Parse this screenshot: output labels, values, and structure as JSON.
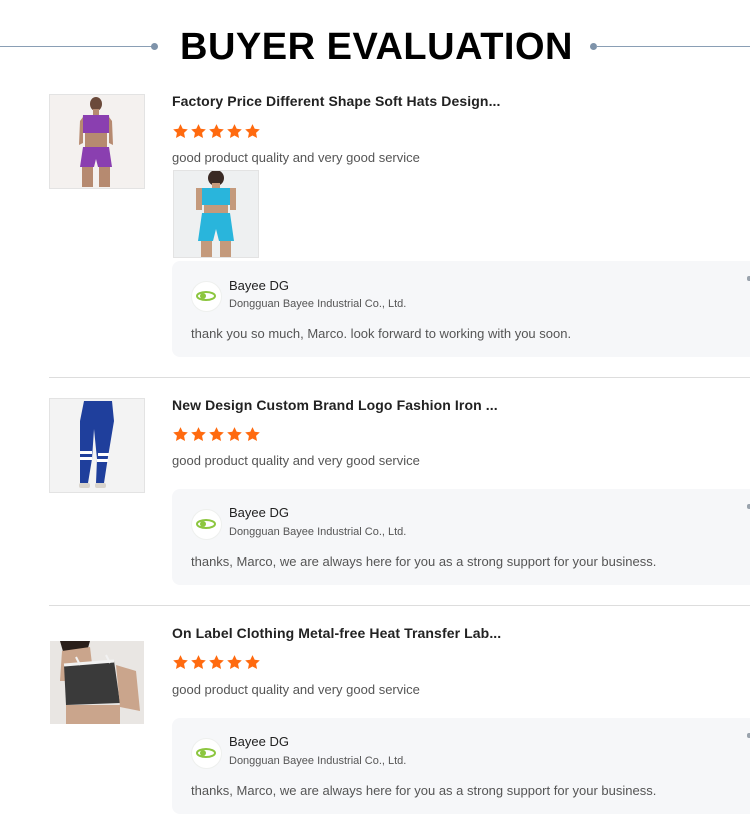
{
  "header": {
    "title": "BUYER EVALUATION"
  },
  "colors": {
    "star": "#ff6a0f",
    "reply_bg": "#f6f7f9",
    "divider": "#dddddd",
    "header_line": "#8a9fb5"
  },
  "reviews": [
    {
      "product_title": "Factory Price Different Shape Soft Hats Design...",
      "rating": 5,
      "comment": "good product quality and very good service",
      "reply": {
        "name": "Bayee DG",
        "company": "Dongguan Bayee Industrial Co., Ltd.",
        "text": "thank you so much, Marco. look forward to working with you soon."
      }
    },
    {
      "product_title": "New Design Custom Brand Logo Fashion Iron ...",
      "rating": 5,
      "comment": "good product quality and very good service",
      "reply": {
        "name": "Bayee DG",
        "company": "Dongguan Bayee Industrial Co., Ltd.",
        "text": "thanks, Marco, we are always here for you as a strong support for your business."
      }
    },
    {
      "product_title": "On Label Clothing Metal-free Heat Transfer Lab...",
      "rating": 5,
      "comment": "good product quality and very good service",
      "reply": {
        "name": "Bayee DG",
        "company": "Dongguan Bayee Industrial Co., Ltd.",
        "text": "thanks, Marco, we are always here for you as a strong support for your business."
      }
    }
  ]
}
